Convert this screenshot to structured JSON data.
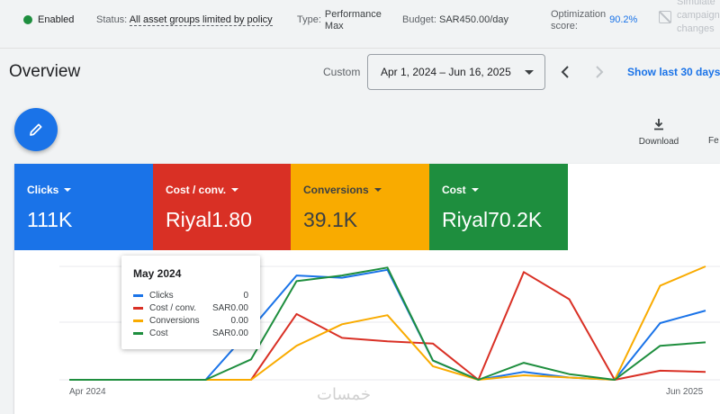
{
  "status": {
    "enabled_label": "Enabled",
    "status_label": "Status:",
    "status_value": "All asset groups limited by policy",
    "type_label": "Type:",
    "type_value_line1": "Performance",
    "type_value_line2": "Max",
    "budget_label": "Budget:",
    "budget_value": "SAR450.00/day",
    "opt_label_line1": "Optimization",
    "opt_label_line2": "score:",
    "opt_value": "90.2%",
    "sim_line1": "Simulate",
    "sim_line2": "campaign",
    "sim_line3": "changes"
  },
  "header": {
    "title": "Overview",
    "custom_label": "Custom",
    "date_range": "Apr 1, 2024 – Jun 16, 2025",
    "show_last": "Show last 30 days"
  },
  "actions": {
    "download_label": "Download",
    "fe_label": "Fe"
  },
  "metrics": [
    {
      "label": "Clicks",
      "value": "111K",
      "color": "#1a73e8"
    },
    {
      "label": "Cost / conv.",
      "value": "Riyal1.80",
      "color": "#d93025"
    },
    {
      "label": "Conversions",
      "value": "39.1K",
      "color": "#f9ab00"
    },
    {
      "label": "Cost",
      "value": "Riyal70.2K",
      "color": "#1e8e3e"
    }
  ],
  "tooltip": {
    "title": "May 2024",
    "rows": [
      {
        "name": "Clicks",
        "value": "0",
        "color": "#1a73e8"
      },
      {
        "name": "Cost / conv.",
        "value": "SAR0.00",
        "color": "#d93025"
      },
      {
        "name": "Conversions",
        "value": "0.00",
        "color": "#f9ab00"
      },
      {
        "name": "Cost",
        "value": "SAR0.00",
        "color": "#1e8e3e"
      }
    ]
  },
  "chart_data": {
    "type": "line",
    "x_start_label": "Apr 2024",
    "x_end_label": "Jun 2025",
    "grid": true,
    "series": [
      {
        "name": "Clicks",
        "color": "#1a73e8",
        "values": [
          0,
          0,
          0,
          0,
          0.45,
          0.92,
          0.9,
          0.97,
          0.17,
          0,
          0.07,
          0.02,
          0,
          0.5,
          0.61
        ]
      },
      {
        "name": "Cost / conv.",
        "color": "#d93025",
        "values": [
          0,
          0,
          0,
          0,
          0,
          0.58,
          0.37,
          0.34,
          0.32,
          0,
          0.95,
          0.71,
          0,
          0.08,
          0.07
        ]
      },
      {
        "name": "Conversions",
        "color": "#f9ab00",
        "values": [
          0,
          0,
          0,
          0,
          0,
          0.3,
          0.49,
          0.57,
          0.12,
          0,
          0.04,
          0.02,
          0,
          0.83,
          1.0
        ]
      },
      {
        "name": "Cost",
        "color": "#1e8e3e",
        "values": [
          0,
          0,
          0,
          0,
          0.18,
          0.87,
          0.92,
          0.99,
          0.17,
          0,
          0.15,
          0.05,
          0,
          0.3,
          0.33
        ]
      }
    ]
  },
  "watermark": "خمسات"
}
